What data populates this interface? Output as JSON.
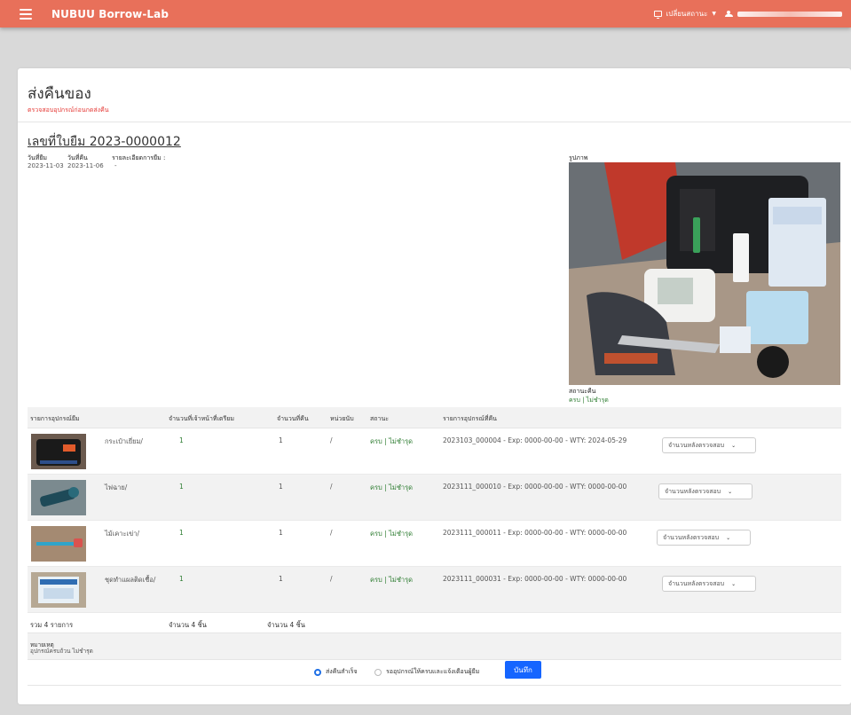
{
  "app": {
    "brand": "NUBUU Borrow-Lab"
  },
  "topbar": {
    "status_menu": "เปลี่ยนสถานะ",
    "user_name": ""
  },
  "page": {
    "title": "ส่งคืนของ",
    "subtitle": "ตรวจสอบอุปกรณ์ก่อนกดส่งคืน"
  },
  "doc": {
    "number_text": "เลขที่ใบยืม 2023-0000012",
    "borrow_date_label": "วันที่ยืม",
    "borrow_date": "2023-11-03",
    "return_date_label": "วันที่คืน",
    "return_date": "2023-11-06",
    "detail_label": "รายละเอียดการยืม :",
    "detail": "-"
  },
  "photo": {
    "label": "รูปภาพ",
    "return_status_label": "สถานะคืน",
    "return_status": "ครบ | ไม่ชำรุด"
  },
  "table": {
    "headers": {
      "item": "รายการอุปกรณ์ยืม",
      "prepared": "จำนวนที่เจ้าหน้าที่เตรียม",
      "returned": "จำนวนที่คืน",
      "unit": "หน่วยนับ",
      "status": "สถานะ",
      "return_items": "รายการอุปกรณ์ที่คืน"
    },
    "rows": [
      {
        "name": "กระเป๋าเยี่ยม/",
        "prepared": "1",
        "returned": "1",
        "unit": "/",
        "status": "ครบ | ไม่ชำรุด",
        "detail": "2023103_000004 - Exp: 0000-00-00 - WTY: 2024-05-29",
        "select": "จำนวนหลังตรวจสอบ"
      },
      {
        "name": "ไฟฉาย/",
        "prepared": "1",
        "returned": "1",
        "unit": "/",
        "status": "ครบ | ไม่ชำรุด",
        "detail": "2023111_000010 - Exp: 0000-00-00 - WTY: 0000-00-00",
        "select": "จำนวนหลังตรวจสอบ"
      },
      {
        "name": "ไม้เคาะเข่า/",
        "prepared": "1",
        "returned": "1",
        "unit": "/",
        "status": "ครบ | ไม่ชำรุด",
        "detail": "2023111_000011 - Exp: 0000-00-00 - WTY: 0000-00-00",
        "select": "จำนวนหลังตรวจสอบ"
      },
      {
        "name": "ชุดทำแผลติดเชื้อ/",
        "prepared": "1",
        "returned": "1",
        "unit": "/",
        "status": "ครบ | ไม่ชำรุด",
        "detail": "2023111_000031 - Exp: 0000-00-00 - WTY: 0000-00-00",
        "select": "จำนวนหลังตรวจสอบ"
      }
    ],
    "footer": {
      "total_items": "รวม 4 รายการ",
      "total_prepared": "จำนวน 4 ชิ้น",
      "total_returned": "จำนวน 4 ชิ้น"
    },
    "note_label": "หมายเหตุ",
    "note_value": "อุปกรณ์ครบถ้วน ไม่ชำรุด"
  },
  "actions": {
    "radio_success": "ส่งคืนสำเร็จ",
    "radio_wait": "รออุปกรณ์ให้ครบและแจ้งเตือนผู้ยืม",
    "save": "บันทึก"
  },
  "colors": {
    "topbar": "#e8705a",
    "accent": "#1565ff",
    "ok_green": "#2e7d32",
    "warn_red": "#e53935"
  },
  "icons": [
    "menu-icon",
    "monitor-icon",
    "user-icon",
    "chevron-down-icon"
  ]
}
